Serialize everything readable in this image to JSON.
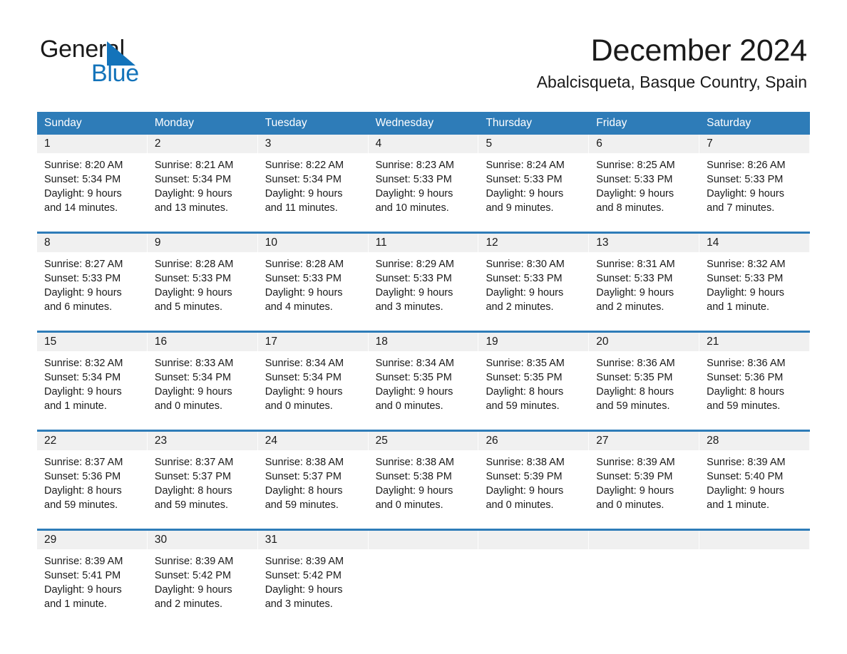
{
  "brand": {
    "name_part1": "General",
    "name_part2": "Blue",
    "accent_color": "#1373ba"
  },
  "header": {
    "title": "December 2024",
    "subtitle": "Abalcisqueta, Basque Country, Spain"
  },
  "colors": {
    "header_blue": "#2e7cb8",
    "day_band_gray": "#f0f0f0",
    "text": "#1a1a1a"
  },
  "weekdays": [
    "Sunday",
    "Monday",
    "Tuesday",
    "Wednesday",
    "Thursday",
    "Friday",
    "Saturday"
  ],
  "weeks": [
    {
      "days": [
        {
          "num": "1",
          "sunrise": "Sunrise: 8:20 AM",
          "sunset": "Sunset: 5:34 PM",
          "daylight1": "Daylight: 9 hours",
          "daylight2": "and 14 minutes."
        },
        {
          "num": "2",
          "sunrise": "Sunrise: 8:21 AM",
          "sunset": "Sunset: 5:34 PM",
          "daylight1": "Daylight: 9 hours",
          "daylight2": "and 13 minutes."
        },
        {
          "num": "3",
          "sunrise": "Sunrise: 8:22 AM",
          "sunset": "Sunset: 5:34 PM",
          "daylight1": "Daylight: 9 hours",
          "daylight2": "and 11 minutes."
        },
        {
          "num": "4",
          "sunrise": "Sunrise: 8:23 AM",
          "sunset": "Sunset: 5:33 PM",
          "daylight1": "Daylight: 9 hours",
          "daylight2": "and 10 minutes."
        },
        {
          "num": "5",
          "sunrise": "Sunrise: 8:24 AM",
          "sunset": "Sunset: 5:33 PM",
          "daylight1": "Daylight: 9 hours",
          "daylight2": "and 9 minutes."
        },
        {
          "num": "6",
          "sunrise": "Sunrise: 8:25 AM",
          "sunset": "Sunset: 5:33 PM",
          "daylight1": "Daylight: 9 hours",
          "daylight2": "and 8 minutes."
        },
        {
          "num": "7",
          "sunrise": "Sunrise: 8:26 AM",
          "sunset": "Sunset: 5:33 PM",
          "daylight1": "Daylight: 9 hours",
          "daylight2": "and 7 minutes."
        }
      ]
    },
    {
      "days": [
        {
          "num": "8",
          "sunrise": "Sunrise: 8:27 AM",
          "sunset": "Sunset: 5:33 PM",
          "daylight1": "Daylight: 9 hours",
          "daylight2": "and 6 minutes."
        },
        {
          "num": "9",
          "sunrise": "Sunrise: 8:28 AM",
          "sunset": "Sunset: 5:33 PM",
          "daylight1": "Daylight: 9 hours",
          "daylight2": "and 5 minutes."
        },
        {
          "num": "10",
          "sunrise": "Sunrise: 8:28 AM",
          "sunset": "Sunset: 5:33 PM",
          "daylight1": "Daylight: 9 hours",
          "daylight2": "and 4 minutes."
        },
        {
          "num": "11",
          "sunrise": "Sunrise: 8:29 AM",
          "sunset": "Sunset: 5:33 PM",
          "daylight1": "Daylight: 9 hours",
          "daylight2": "and 3 minutes."
        },
        {
          "num": "12",
          "sunrise": "Sunrise: 8:30 AM",
          "sunset": "Sunset: 5:33 PM",
          "daylight1": "Daylight: 9 hours",
          "daylight2": "and 2 minutes."
        },
        {
          "num": "13",
          "sunrise": "Sunrise: 8:31 AM",
          "sunset": "Sunset: 5:33 PM",
          "daylight1": "Daylight: 9 hours",
          "daylight2": "and 2 minutes."
        },
        {
          "num": "14",
          "sunrise": "Sunrise: 8:32 AM",
          "sunset": "Sunset: 5:33 PM",
          "daylight1": "Daylight: 9 hours",
          "daylight2": "and 1 minute."
        }
      ]
    },
    {
      "days": [
        {
          "num": "15",
          "sunrise": "Sunrise: 8:32 AM",
          "sunset": "Sunset: 5:34 PM",
          "daylight1": "Daylight: 9 hours",
          "daylight2": "and 1 minute."
        },
        {
          "num": "16",
          "sunrise": "Sunrise: 8:33 AM",
          "sunset": "Sunset: 5:34 PM",
          "daylight1": "Daylight: 9 hours",
          "daylight2": "and 0 minutes."
        },
        {
          "num": "17",
          "sunrise": "Sunrise: 8:34 AM",
          "sunset": "Sunset: 5:34 PM",
          "daylight1": "Daylight: 9 hours",
          "daylight2": "and 0 minutes."
        },
        {
          "num": "18",
          "sunrise": "Sunrise: 8:34 AM",
          "sunset": "Sunset: 5:35 PM",
          "daylight1": "Daylight: 9 hours",
          "daylight2": "and 0 minutes."
        },
        {
          "num": "19",
          "sunrise": "Sunrise: 8:35 AM",
          "sunset": "Sunset: 5:35 PM",
          "daylight1": "Daylight: 8 hours",
          "daylight2": "and 59 minutes."
        },
        {
          "num": "20",
          "sunrise": "Sunrise: 8:36 AM",
          "sunset": "Sunset: 5:35 PM",
          "daylight1": "Daylight: 8 hours",
          "daylight2": "and 59 minutes."
        },
        {
          "num": "21",
          "sunrise": "Sunrise: 8:36 AM",
          "sunset": "Sunset: 5:36 PM",
          "daylight1": "Daylight: 8 hours",
          "daylight2": "and 59 minutes."
        }
      ]
    },
    {
      "days": [
        {
          "num": "22",
          "sunrise": "Sunrise: 8:37 AM",
          "sunset": "Sunset: 5:36 PM",
          "daylight1": "Daylight: 8 hours",
          "daylight2": "and 59 minutes."
        },
        {
          "num": "23",
          "sunrise": "Sunrise: 8:37 AM",
          "sunset": "Sunset: 5:37 PM",
          "daylight1": "Daylight: 8 hours",
          "daylight2": "and 59 minutes."
        },
        {
          "num": "24",
          "sunrise": "Sunrise: 8:38 AM",
          "sunset": "Sunset: 5:37 PM",
          "daylight1": "Daylight: 8 hours",
          "daylight2": "and 59 minutes."
        },
        {
          "num": "25",
          "sunrise": "Sunrise: 8:38 AM",
          "sunset": "Sunset: 5:38 PM",
          "daylight1": "Daylight: 9 hours",
          "daylight2": "and 0 minutes."
        },
        {
          "num": "26",
          "sunrise": "Sunrise: 8:38 AM",
          "sunset": "Sunset: 5:39 PM",
          "daylight1": "Daylight: 9 hours",
          "daylight2": "and 0 minutes."
        },
        {
          "num": "27",
          "sunrise": "Sunrise: 8:39 AM",
          "sunset": "Sunset: 5:39 PM",
          "daylight1": "Daylight: 9 hours",
          "daylight2": "and 0 minutes."
        },
        {
          "num": "28",
          "sunrise": "Sunrise: 8:39 AM",
          "sunset": "Sunset: 5:40 PM",
          "daylight1": "Daylight: 9 hours",
          "daylight2": "and 1 minute."
        }
      ]
    },
    {
      "days": [
        {
          "num": "29",
          "sunrise": "Sunrise: 8:39 AM",
          "sunset": "Sunset: 5:41 PM",
          "daylight1": "Daylight: 9 hours",
          "daylight2": "and 1 minute."
        },
        {
          "num": "30",
          "sunrise": "Sunrise: 8:39 AM",
          "sunset": "Sunset: 5:42 PM",
          "daylight1": "Daylight: 9 hours",
          "daylight2": "and 2 minutes."
        },
        {
          "num": "31",
          "sunrise": "Sunrise: 8:39 AM",
          "sunset": "Sunset: 5:42 PM",
          "daylight1": "Daylight: 9 hours",
          "daylight2": "and 3 minutes."
        },
        {
          "num": "",
          "sunrise": "",
          "sunset": "",
          "daylight1": "",
          "daylight2": ""
        },
        {
          "num": "",
          "sunrise": "",
          "sunset": "",
          "daylight1": "",
          "daylight2": ""
        },
        {
          "num": "",
          "sunrise": "",
          "sunset": "",
          "daylight1": "",
          "daylight2": ""
        },
        {
          "num": "",
          "sunrise": "",
          "sunset": "",
          "daylight1": "",
          "daylight2": ""
        }
      ]
    }
  ]
}
